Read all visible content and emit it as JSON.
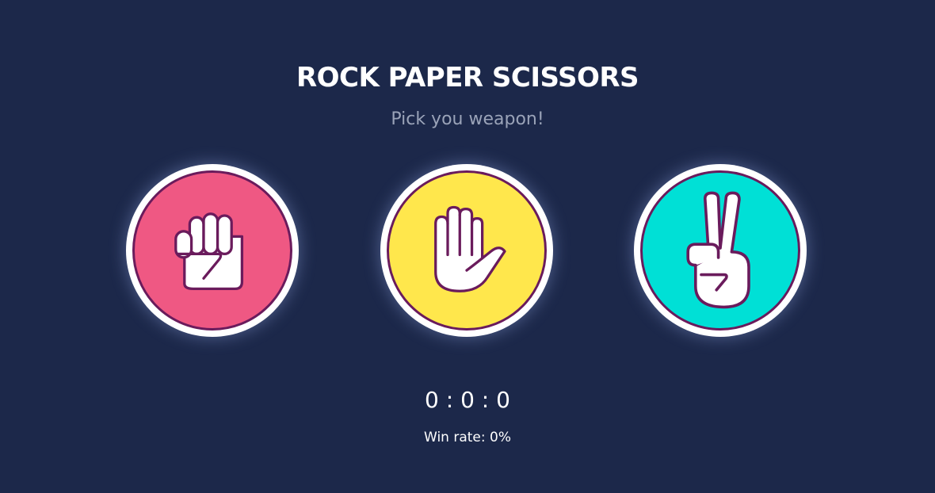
{
  "title": "ROCK PAPER SCISSORS",
  "subtitle": "Pick you weapon!",
  "weapons": [
    {
      "id": "rock",
      "icon": "fist-icon",
      "color": "#ef5883"
    },
    {
      "id": "paper",
      "icon": "open-hand-icon",
      "color": "#ffe74c"
    },
    {
      "id": "scissors",
      "icon": "peace-hand-icon",
      "color": "#00e0d6"
    }
  ],
  "score": {
    "text": "0 : 0 : 0"
  },
  "win_rate": {
    "text": "Win rate: 0%"
  },
  "colors": {
    "background": "#1c284a",
    "outline": "#6a1b5c"
  }
}
